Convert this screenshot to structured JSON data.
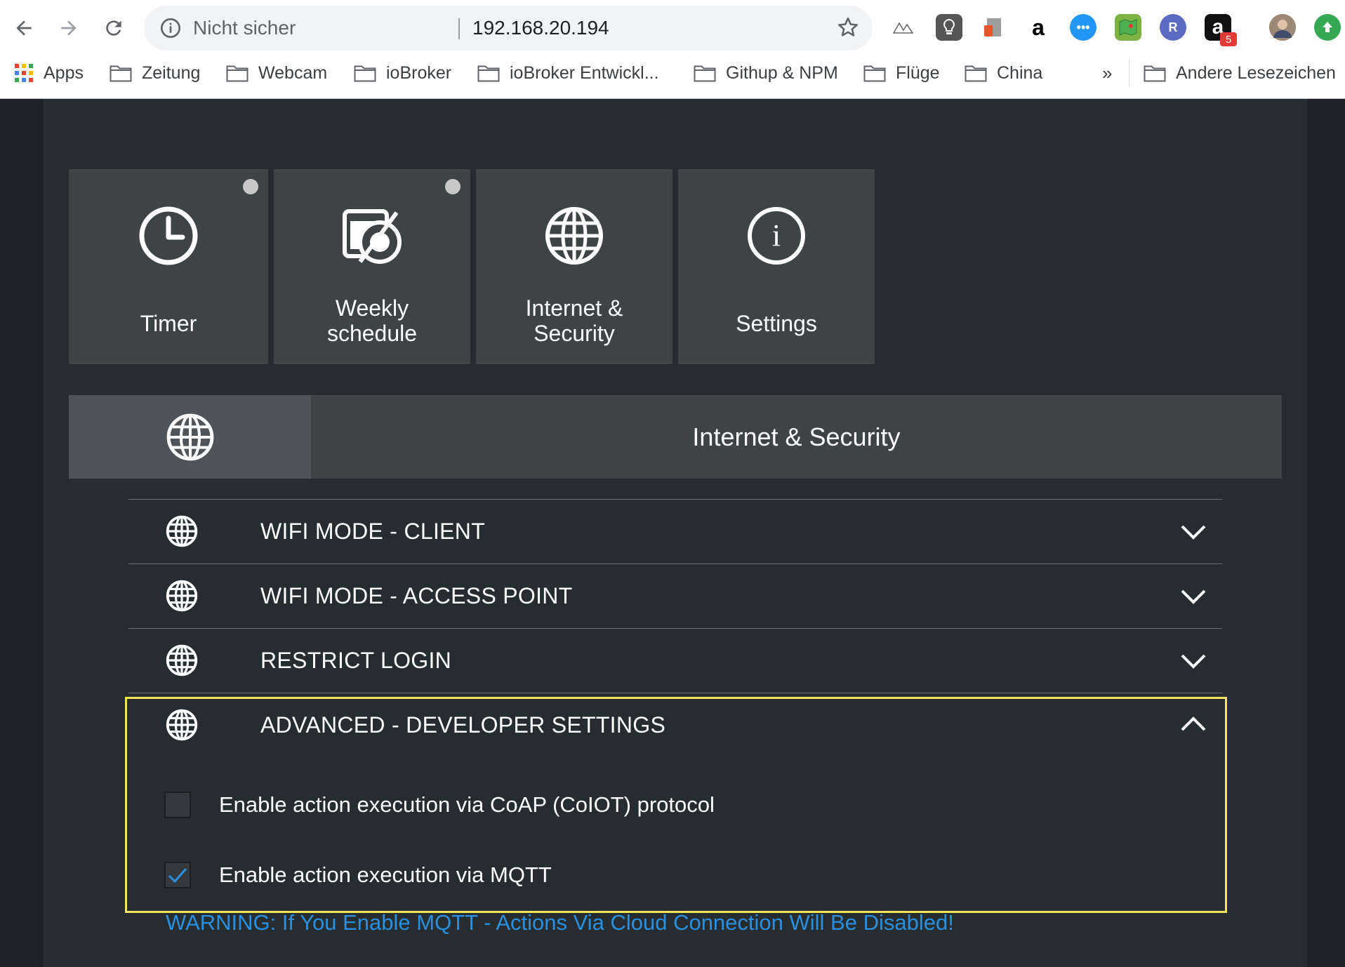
{
  "browser": {
    "security_label": "Nicht sicher",
    "url": "192.168.20.194",
    "bookmarks": [
      {
        "label": "Apps"
      },
      {
        "label": "Zeitung"
      },
      {
        "label": "Webcam"
      },
      {
        "label": "ioBroker"
      },
      {
        "label": "ioBroker Entwickl..."
      },
      {
        "label": "Githup & NPM"
      },
      {
        "label": "Flüge"
      },
      {
        "label": "China"
      }
    ],
    "overflow": "»",
    "other_bookmarks": "Andere Lesezeichen",
    "extensions": [
      {
        "icon": "mountains-icon"
      },
      {
        "icon": "lightbulb-icon"
      },
      {
        "icon": "office-icon"
      },
      {
        "icon": "amazon-icon",
        "glyph": "a"
      },
      {
        "icon": "chat-icon"
      },
      {
        "icon": "map-icon"
      },
      {
        "icon": "r-extension-icon",
        "glyph": "R"
      },
      {
        "icon": "amazon-assistant-icon",
        "glyph": "a",
        "badge": "5"
      },
      {
        "icon": "profile-avatar"
      },
      {
        "icon": "update-icon"
      }
    ]
  },
  "tiles": [
    {
      "label": "Timer",
      "icon": "clock-icon",
      "dot": true
    },
    {
      "label": "Weekly schedule",
      "icon": "schedule-icon",
      "dot": true
    },
    {
      "label": "Internet & Security",
      "icon": "globe-icon",
      "dot": false
    },
    {
      "label": "Settings",
      "icon": "info-icon",
      "dot": false
    }
  ],
  "section": {
    "title": "Internet & Security",
    "icon": "globe-icon"
  },
  "accordion": [
    {
      "label": "WIFI MODE - CLIENT",
      "expanded": false
    },
    {
      "label": "WIFI MODE - ACCESS POINT",
      "expanded": false
    },
    {
      "label": "RESTRICT LOGIN",
      "expanded": false
    },
    {
      "label": "ADVANCED - DEVELOPER SETTINGS",
      "expanded": true
    }
  ],
  "advanced": {
    "options": [
      {
        "label": "Enable action execution via CoAP (CoIOT) protocol",
        "checked": false
      },
      {
        "label": "Enable action execution via MQTT",
        "checked": true
      }
    ],
    "warning": "WARNING: If You Enable MQTT - Actions Via Cloud Connection Will Be Disabled!"
  },
  "colors": {
    "page_bg": "#262d30",
    "tile_bg": "#3e4346",
    "highlight_border": "#f2e35b",
    "warning_text": "#2b8fe0",
    "check_color": "#2b8fe0"
  }
}
